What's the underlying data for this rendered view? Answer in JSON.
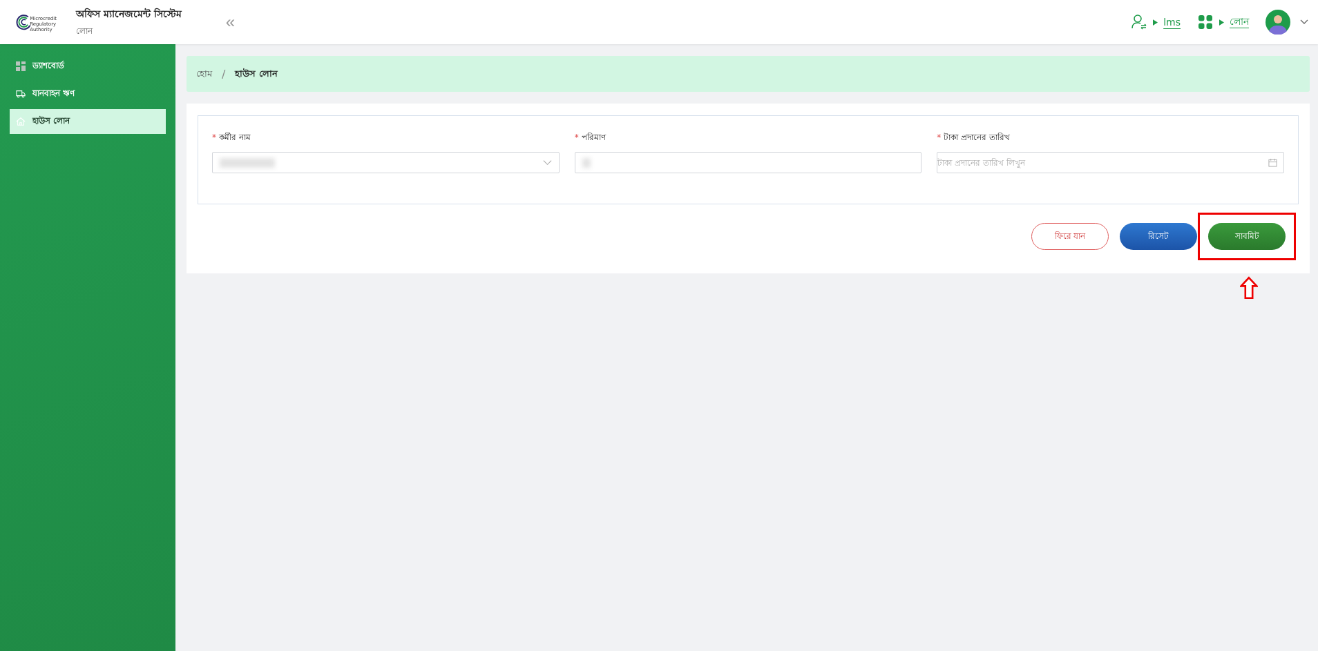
{
  "header": {
    "logo_text": [
      "Microcredit",
      "Regulatory",
      "Authority"
    ],
    "title": "অফিস ম্যানেজমেন্ট সিস্টেম",
    "subtitle": "লোন",
    "collapse_icon": "«",
    "links": [
      {
        "kind": "user-switch",
        "label": "lms"
      },
      {
        "kind": "grid",
        "label": "লোন"
      }
    ]
  },
  "sidebar": {
    "items": [
      {
        "kind": "dashboard",
        "label": "ড্যাশবোর্ড",
        "selected": false
      },
      {
        "kind": "vehicle",
        "label": "যানবাহন ঋণ",
        "selected": false
      },
      {
        "kind": "home",
        "label": "হাউস লোন",
        "selected": true
      }
    ]
  },
  "breadcrumb": {
    "separator": "/",
    "items": [
      {
        "label": "হোম",
        "current": false
      },
      {
        "label": "হাউস লোন",
        "current": true
      }
    ]
  },
  "form": {
    "fields": [
      {
        "kind": "select",
        "label": "কর্মীর নাম",
        "required_mark": "*",
        "blurred": true
      },
      {
        "kind": "text",
        "label": "পরিমাণ",
        "required_mark": "*",
        "blurred": true
      },
      {
        "kind": "date",
        "label": "টাকা প্রদানের তারিখ",
        "required_mark": "*",
        "placeholder": "টাকা প্রদানের তারিখ লিখুন"
      }
    ],
    "buttons": [
      {
        "kind": "back",
        "label": "ফিরে যান",
        "highlighted": false
      },
      {
        "kind": "reset",
        "label": "রিসেট",
        "highlighted": false
      },
      {
        "kind": "submit",
        "label": "সাবমিট",
        "highlighted": true
      }
    ]
  }
}
